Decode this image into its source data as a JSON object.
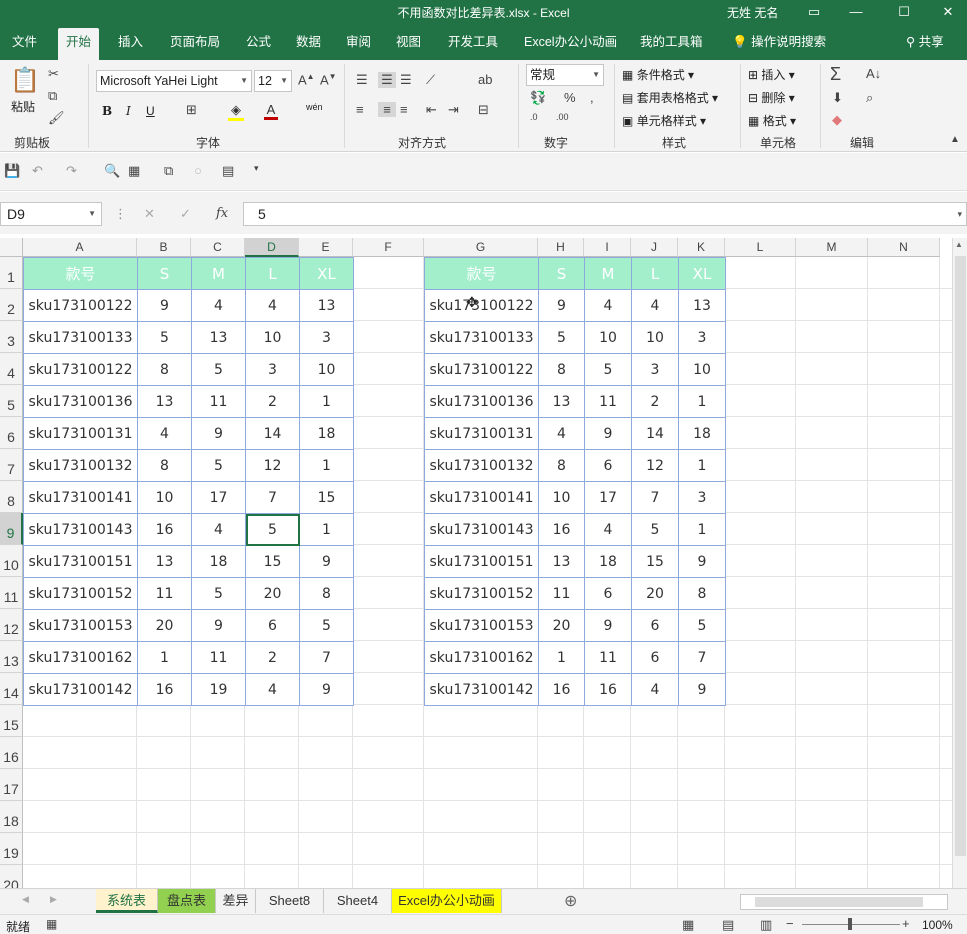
{
  "window": {
    "title": "不用函数对比差异表.xlsx  -  Excel",
    "user": "无姓 无名"
  },
  "ribbon_tabs": [
    "文件",
    "开始",
    "插入",
    "页面布局",
    "公式",
    "数据",
    "审阅",
    "视图",
    "开发工具",
    "Excel办公小动画",
    "我的工具箱",
    "操作说明搜索"
  ],
  "share_label": "共享",
  "ribbon": {
    "clipboard": {
      "paste": "粘贴",
      "label": "剪贴板"
    },
    "font": {
      "name": "Microsoft YaHei Light",
      "size": "12",
      "label": "字体",
      "bold": "B",
      "italic": "I",
      "underline": "U",
      "wen": "wén"
    },
    "alignment": {
      "label": "对齐方式"
    },
    "number": {
      "format": "常规",
      "label": "数字"
    },
    "styles": {
      "conditional": "条件格式",
      "table": "套用表格格式",
      "cell": "单元格样式",
      "label": "样式"
    },
    "cells": {
      "insert": "插入",
      "delete": "删除",
      "format": "格式",
      "label": "单元格"
    },
    "editing": {
      "label": "编辑"
    }
  },
  "formula_bar": {
    "name_box": "D9",
    "fx": "fx",
    "value": "5"
  },
  "columns": [
    "A",
    "B",
    "C",
    "D",
    "E",
    "F",
    "G",
    "H",
    "I",
    "J",
    "K",
    "L",
    "M",
    "N"
  ],
  "rows": [
    "1",
    "2",
    "3",
    "4",
    "5",
    "6",
    "7",
    "8",
    "9",
    "10",
    "11",
    "12",
    "13",
    "14",
    "15",
    "16",
    "17",
    "18",
    "19",
    "20"
  ],
  "selected_cell": {
    "col": "D",
    "row": "9"
  },
  "table_left": {
    "headers": [
      "款号",
      "S",
      "M",
      "L",
      "XL"
    ],
    "rows": [
      [
        "sku173100122",
        "9",
        "4",
        "4",
        "13"
      ],
      [
        "sku173100133",
        "5",
        "13",
        "10",
        "3"
      ],
      [
        "sku173100122",
        "8",
        "5",
        "3",
        "10"
      ],
      [
        "sku173100136",
        "13",
        "11",
        "2",
        "1"
      ],
      [
        "sku173100131",
        "4",
        "9",
        "14",
        "18"
      ],
      [
        "sku173100132",
        "8",
        "5",
        "12",
        "1"
      ],
      [
        "sku173100141",
        "10",
        "17",
        "7",
        "15"
      ],
      [
        "sku173100143",
        "16",
        "4",
        "5",
        "1"
      ],
      [
        "sku173100151",
        "13",
        "18",
        "15",
        "9"
      ],
      [
        "sku173100152",
        "11",
        "5",
        "20",
        "8"
      ],
      [
        "sku173100153",
        "20",
        "9",
        "6",
        "5"
      ],
      [
        "sku173100162",
        "1",
        "11",
        "2",
        "7"
      ],
      [
        "sku173100142",
        "16",
        "19",
        "4",
        "9"
      ]
    ]
  },
  "table_right": {
    "headers": [
      "款号",
      "S",
      "M",
      "L",
      "XL"
    ],
    "rows": [
      [
        "sku173100122",
        "9",
        "4",
        "4",
        "13"
      ],
      [
        "sku173100133",
        "5",
        "10",
        "10",
        "3"
      ],
      [
        "sku173100122",
        "8",
        "5",
        "3",
        "10"
      ],
      [
        "sku173100136",
        "13",
        "11",
        "2",
        "1"
      ],
      [
        "sku173100131",
        "4",
        "9",
        "14",
        "18"
      ],
      [
        "sku173100132",
        "8",
        "6",
        "12",
        "1"
      ],
      [
        "sku173100141",
        "10",
        "17",
        "7",
        "3"
      ],
      [
        "sku173100143",
        "16",
        "4",
        "5",
        "1"
      ],
      [
        "sku173100151",
        "13",
        "18",
        "15",
        "9"
      ],
      [
        "sku173100152",
        "11",
        "6",
        "20",
        "8"
      ],
      [
        "sku173100153",
        "20",
        "9",
        "6",
        "5"
      ],
      [
        "sku173100162",
        "1",
        "11",
        "6",
        "7"
      ],
      [
        "sku173100142",
        "16",
        "16",
        "4",
        "9"
      ]
    ]
  },
  "sheet_tabs": [
    {
      "label": "系统表",
      "color": "#fff2cc",
      "active": true
    },
    {
      "label": "盘点表",
      "color": "#92d050",
      "active": false
    },
    {
      "label": "差异",
      "color": "",
      "active": false
    },
    {
      "label": "Sheet8",
      "color": "",
      "active": false
    },
    {
      "label": "Sheet4",
      "color": "",
      "active": false
    },
    {
      "label": "Excel办公小动画",
      "color": "#ffff00",
      "active": false
    }
  ],
  "status": {
    "ready": "就绪",
    "zoom": "100%"
  },
  "colors": {
    "brand": "#217346",
    "header_fill": "#a3efcc",
    "border": "#8ea9db"
  }
}
